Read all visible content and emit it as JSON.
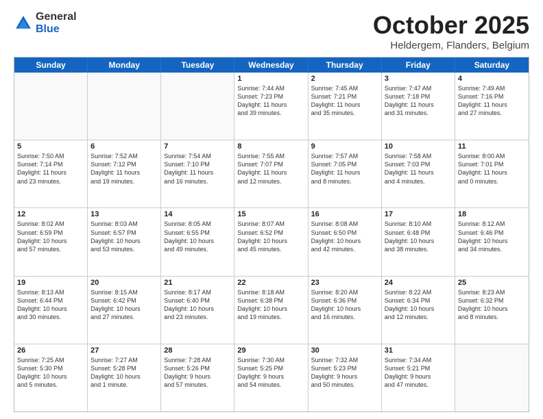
{
  "header": {
    "logo_general": "General",
    "logo_blue": "Blue",
    "month_title": "October 2025",
    "location": "Heldergem, Flanders, Belgium"
  },
  "days_of_week": [
    "Sunday",
    "Monday",
    "Tuesday",
    "Wednesday",
    "Thursday",
    "Friday",
    "Saturday"
  ],
  "weeks": [
    [
      {
        "day": "",
        "empty": true
      },
      {
        "day": "",
        "empty": true
      },
      {
        "day": "",
        "empty": true
      },
      {
        "day": "1",
        "lines": [
          "Sunrise: 7:44 AM",
          "Sunset: 7:23 PM",
          "Daylight: 11 hours",
          "and 39 minutes."
        ]
      },
      {
        "day": "2",
        "lines": [
          "Sunrise: 7:45 AM",
          "Sunset: 7:21 PM",
          "Daylight: 11 hours",
          "and 35 minutes."
        ]
      },
      {
        "day": "3",
        "lines": [
          "Sunrise: 7:47 AM",
          "Sunset: 7:18 PM",
          "Daylight: 11 hours",
          "and 31 minutes."
        ]
      },
      {
        "day": "4",
        "lines": [
          "Sunrise: 7:49 AM",
          "Sunset: 7:16 PM",
          "Daylight: 11 hours",
          "and 27 minutes."
        ]
      }
    ],
    [
      {
        "day": "5",
        "lines": [
          "Sunrise: 7:50 AM",
          "Sunset: 7:14 PM",
          "Daylight: 11 hours",
          "and 23 minutes."
        ]
      },
      {
        "day": "6",
        "lines": [
          "Sunrise: 7:52 AM",
          "Sunset: 7:12 PM",
          "Daylight: 11 hours",
          "and 19 minutes."
        ]
      },
      {
        "day": "7",
        "lines": [
          "Sunrise: 7:54 AM",
          "Sunset: 7:10 PM",
          "Daylight: 11 hours",
          "and 16 minutes."
        ]
      },
      {
        "day": "8",
        "lines": [
          "Sunrise: 7:55 AM",
          "Sunset: 7:07 PM",
          "Daylight: 11 hours",
          "and 12 minutes."
        ]
      },
      {
        "day": "9",
        "lines": [
          "Sunrise: 7:57 AM",
          "Sunset: 7:05 PM",
          "Daylight: 11 hours",
          "and 8 minutes."
        ]
      },
      {
        "day": "10",
        "lines": [
          "Sunrise: 7:58 AM",
          "Sunset: 7:03 PM",
          "Daylight: 11 hours",
          "and 4 minutes."
        ]
      },
      {
        "day": "11",
        "lines": [
          "Sunrise: 8:00 AM",
          "Sunset: 7:01 PM",
          "Daylight: 11 hours",
          "and 0 minutes."
        ]
      }
    ],
    [
      {
        "day": "12",
        "lines": [
          "Sunrise: 8:02 AM",
          "Sunset: 6:59 PM",
          "Daylight: 10 hours",
          "and 57 minutes."
        ]
      },
      {
        "day": "13",
        "lines": [
          "Sunrise: 8:03 AM",
          "Sunset: 6:57 PM",
          "Daylight: 10 hours",
          "and 53 minutes."
        ]
      },
      {
        "day": "14",
        "lines": [
          "Sunrise: 8:05 AM",
          "Sunset: 6:55 PM",
          "Daylight: 10 hours",
          "and 49 minutes."
        ]
      },
      {
        "day": "15",
        "lines": [
          "Sunrise: 8:07 AM",
          "Sunset: 6:52 PM",
          "Daylight: 10 hours",
          "and 45 minutes."
        ]
      },
      {
        "day": "16",
        "lines": [
          "Sunrise: 8:08 AM",
          "Sunset: 6:50 PM",
          "Daylight: 10 hours",
          "and 42 minutes."
        ]
      },
      {
        "day": "17",
        "lines": [
          "Sunrise: 8:10 AM",
          "Sunset: 6:48 PM",
          "Daylight: 10 hours",
          "and 38 minutes."
        ]
      },
      {
        "day": "18",
        "lines": [
          "Sunrise: 8:12 AM",
          "Sunset: 6:46 PM",
          "Daylight: 10 hours",
          "and 34 minutes."
        ]
      }
    ],
    [
      {
        "day": "19",
        "lines": [
          "Sunrise: 8:13 AM",
          "Sunset: 6:44 PM",
          "Daylight: 10 hours",
          "and 30 minutes."
        ]
      },
      {
        "day": "20",
        "lines": [
          "Sunrise: 8:15 AM",
          "Sunset: 6:42 PM",
          "Daylight: 10 hours",
          "and 27 minutes."
        ]
      },
      {
        "day": "21",
        "lines": [
          "Sunrise: 8:17 AM",
          "Sunset: 6:40 PM",
          "Daylight: 10 hours",
          "and 23 minutes."
        ]
      },
      {
        "day": "22",
        "lines": [
          "Sunrise: 8:18 AM",
          "Sunset: 6:38 PM",
          "Daylight: 10 hours",
          "and 19 minutes."
        ]
      },
      {
        "day": "23",
        "lines": [
          "Sunrise: 8:20 AM",
          "Sunset: 6:36 PM",
          "Daylight: 10 hours",
          "and 16 minutes."
        ]
      },
      {
        "day": "24",
        "lines": [
          "Sunrise: 8:22 AM",
          "Sunset: 6:34 PM",
          "Daylight: 10 hours",
          "and 12 minutes."
        ]
      },
      {
        "day": "25",
        "lines": [
          "Sunrise: 8:23 AM",
          "Sunset: 6:32 PM",
          "Daylight: 10 hours",
          "and 8 minutes."
        ]
      }
    ],
    [
      {
        "day": "26",
        "lines": [
          "Sunrise: 7:25 AM",
          "Sunset: 5:30 PM",
          "Daylight: 10 hours",
          "and 5 minutes."
        ]
      },
      {
        "day": "27",
        "lines": [
          "Sunrise: 7:27 AM",
          "Sunset: 5:28 PM",
          "Daylight: 10 hours",
          "and 1 minute."
        ]
      },
      {
        "day": "28",
        "lines": [
          "Sunrise: 7:28 AM",
          "Sunset: 5:26 PM",
          "Daylight: 9 hours",
          "and 57 minutes."
        ]
      },
      {
        "day": "29",
        "lines": [
          "Sunrise: 7:30 AM",
          "Sunset: 5:25 PM",
          "Daylight: 9 hours",
          "and 54 minutes."
        ]
      },
      {
        "day": "30",
        "lines": [
          "Sunrise: 7:32 AM",
          "Sunset: 5:23 PM",
          "Daylight: 9 hours",
          "and 50 minutes."
        ]
      },
      {
        "day": "31",
        "lines": [
          "Sunrise: 7:34 AM",
          "Sunset: 5:21 PM",
          "Daylight: 9 hours",
          "and 47 minutes."
        ]
      },
      {
        "day": "",
        "empty": true
      }
    ]
  ]
}
